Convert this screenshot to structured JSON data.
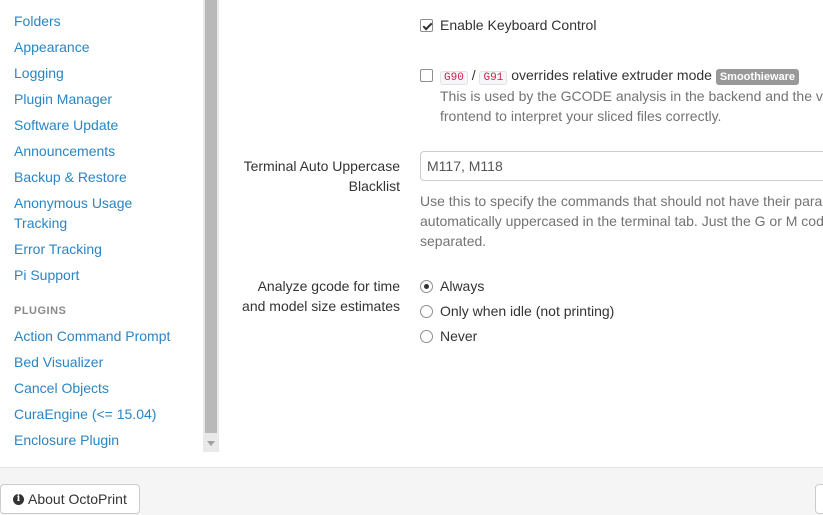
{
  "sidebar": {
    "items": [
      {
        "label": "Folders"
      },
      {
        "label": "Appearance"
      },
      {
        "label": "Logging"
      },
      {
        "label": "Plugin Manager"
      },
      {
        "label": "Software Update"
      },
      {
        "label": "Announcements"
      },
      {
        "label": "Backup & Restore"
      },
      {
        "label": "Anonymous Usage"
      },
      {
        "label": "Tracking"
      },
      {
        "label": "Error Tracking"
      },
      {
        "label": "Pi Support"
      }
    ],
    "plugins_header": "PLUGINS",
    "plugins": [
      {
        "label": "Action Command Prompt"
      },
      {
        "label": "Bed Visualizer"
      },
      {
        "label": "Cancel Objects"
      },
      {
        "label": "CuraEngine (<= 15.04)"
      },
      {
        "label": "Enclosure Plugin"
      }
    ]
  },
  "settings": {
    "keyboard_control": {
      "label": "Enable Keyboard Control",
      "checked": true
    },
    "relative_extruder": {
      "code_a": "G90",
      "separator": "/",
      "code_b": "G91",
      "label": "overrides relative extruder mode",
      "badge": "Smoothieware",
      "checked": false,
      "help_line1": "This is used by the GCODE analysis in the backend and the v",
      "help_line2": "frontend to interpret your sliced files correctly."
    },
    "uppercase_blacklist": {
      "label_line1": "Terminal Auto Uppercase",
      "label_line2": "Blacklist",
      "value": "M117, M118",
      "help_line1": "Use this to specify the commands that should not have their para",
      "help_line2": "automatically uppercased in the terminal tab. Just the G or M cod",
      "help_line3": "separated."
    },
    "analyze_gcode": {
      "label_line1": "Analyze gcode for time",
      "label_line2": "and model size estimates",
      "options": [
        {
          "label": "Always",
          "selected": true
        },
        {
          "label": "Only when idle (not printing)",
          "selected": false
        },
        {
          "label": "Never",
          "selected": false
        }
      ]
    }
  },
  "footer": {
    "about_label": "About OctoPrint",
    "about_icon": "info-circle-icon"
  },
  "colors": {
    "link": "#2a85c4",
    "badge": "#999999",
    "code": "#c7254e",
    "help": "#737373"
  }
}
